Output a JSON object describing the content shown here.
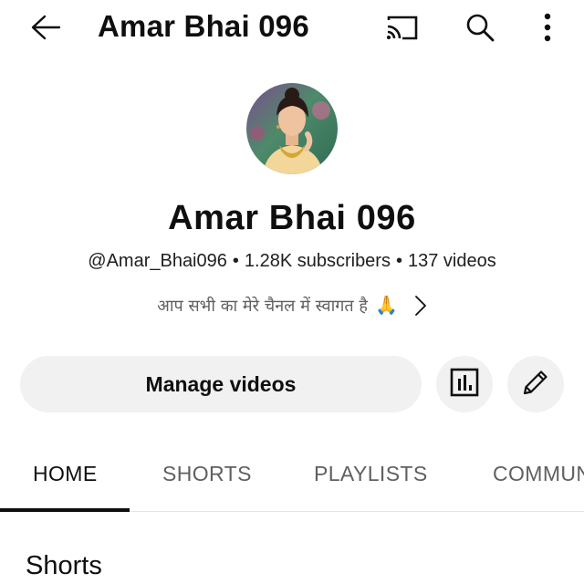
{
  "header": {
    "title": "Amar Bhai 096",
    "icons": [
      "back-arrow-icon",
      "cast-icon",
      "search-icon",
      "more-vert-icon"
    ]
  },
  "channel": {
    "name": "Amar Bhai 096",
    "handle": "@Amar_Bhai096",
    "subscribers": "1.28K subscribers",
    "videos": "137 videos",
    "separator": "•",
    "description": "आप सभी का मेरे चैनल में स्वागत है",
    "description_emoji": "🙏"
  },
  "actions": {
    "manage_label": "Manage videos"
  },
  "tabs": [
    {
      "label": "HOME",
      "active": true
    },
    {
      "label": "SHORTS",
      "active": false
    },
    {
      "label": "PLAYLISTS",
      "active": false
    },
    {
      "label": "COMMUN",
      "active": false
    }
  ],
  "section": {
    "title": "Shorts"
  },
  "colors": {
    "text": "#0f0f0f",
    "secondary_text": "#606060",
    "button_bg": "#f1f1f1",
    "divider": "#e5e5e5"
  }
}
